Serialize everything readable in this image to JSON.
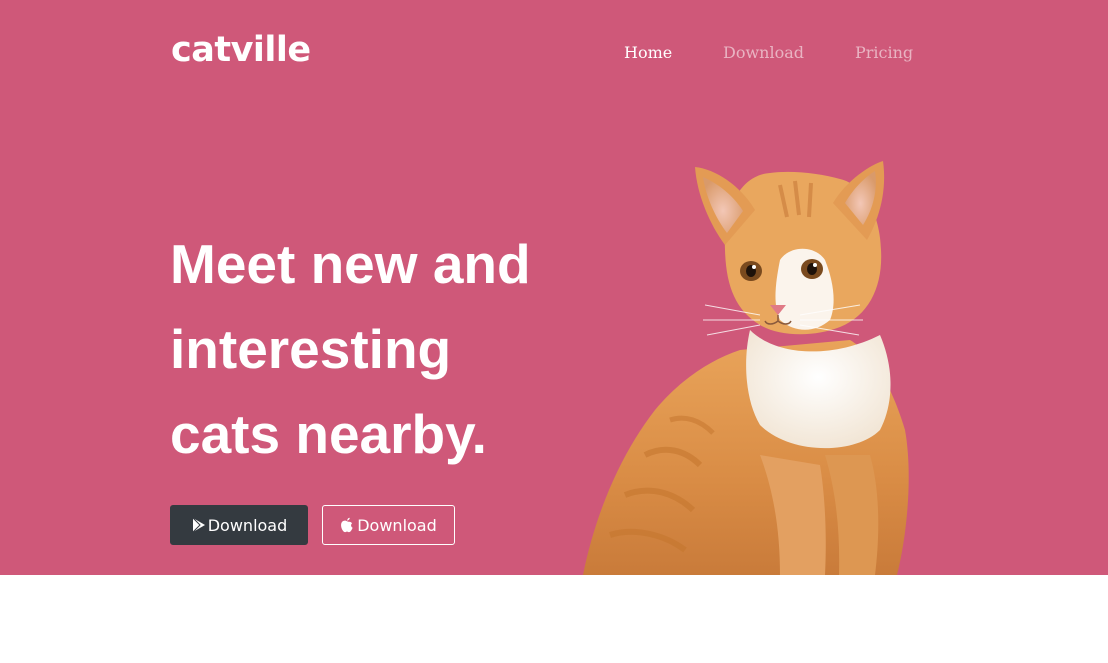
{
  "brand": {
    "name": "catville"
  },
  "nav": {
    "items": [
      {
        "label": "Home",
        "active": true
      },
      {
        "label": "Download",
        "active": false
      },
      {
        "label": "Pricing",
        "active": false
      }
    ]
  },
  "hero": {
    "headline_line1": "Meet new and",
    "headline_line2": "interesting",
    "headline_line3": "cats nearby.",
    "buttons": {
      "google_play": {
        "label": "Download",
        "icon": "play-store-icon"
      },
      "app_store": {
        "label": "Download",
        "icon": "apple-icon"
      }
    },
    "image": {
      "subject": "orange tabby kitten",
      "icon": "cat-photo"
    }
  },
  "colors": {
    "hero_background": "#cf5879",
    "dark_button": "#343a40",
    "text": "#ffffff",
    "nav_muted": "rgba(255,255,255,0.55)"
  }
}
